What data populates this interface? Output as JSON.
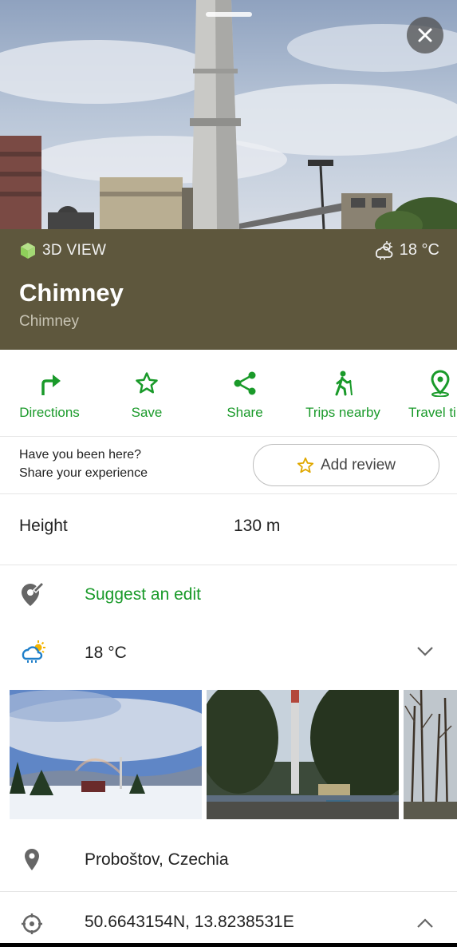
{
  "header": {
    "view_3d_label": "3D VIEW",
    "temperature": "18 °C",
    "title": "Chimney",
    "subtitle": "Chimney"
  },
  "actions": [
    {
      "label": "Directions",
      "icon": "directions-icon"
    },
    {
      "label": "Save",
      "icon": "star-icon"
    },
    {
      "label": "Share",
      "icon": "share-icon"
    },
    {
      "label": "Trips nearby",
      "icon": "hiker-icon"
    },
    {
      "label": "Travel ti",
      "icon": "location-pin-icon"
    }
  ],
  "review": {
    "question_line1": "Have you been here?",
    "question_line2": "Share your experience",
    "button_label": "Add review"
  },
  "details": {
    "height_label": "Height",
    "height_value": "130 m",
    "suggest_edit": "Suggest an edit",
    "weather": "18 °C",
    "location": "Proboštov, Czechia",
    "coordinates": "50.6643154N, 13.8238531E"
  },
  "colors": {
    "accent_green": "#1a9a2a",
    "header_bg": "#5e573d"
  }
}
